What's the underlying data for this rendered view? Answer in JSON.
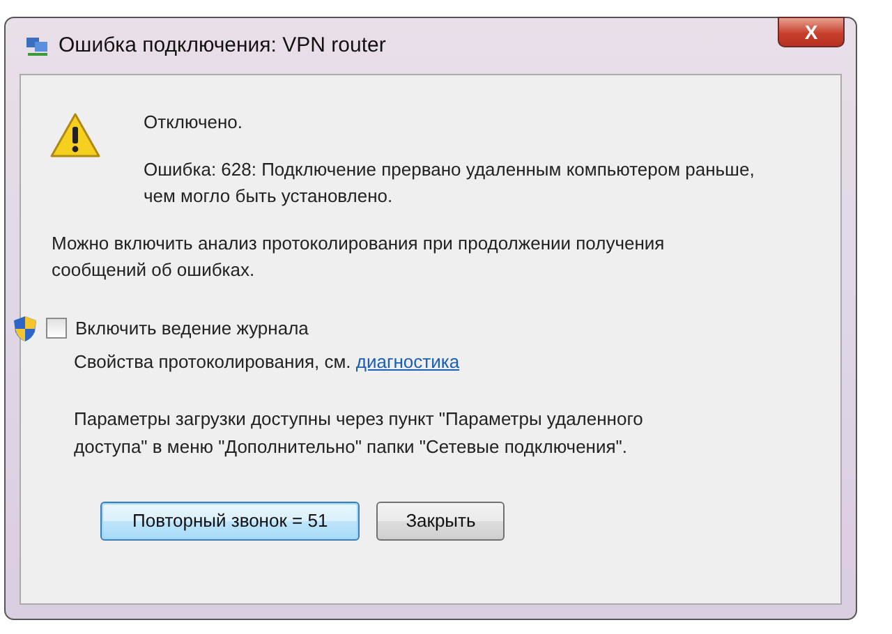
{
  "window": {
    "title": "Ошибка подключения: VPN router",
    "close_label": "X"
  },
  "status": "Отключено.",
  "error": "Ошибка: 628: Подключение прервано удаленным компьютером раньше, чем могло быть установлено.",
  "hint": "Можно включить анализ протоколирования при продолжении получения сообщений об ошибках.",
  "logging": {
    "label": "Включить ведение журнала",
    "checked": false
  },
  "properties": {
    "text": "Свойства протоколирования, см.",
    "link": "диагностика"
  },
  "note": "Параметры загрузки доступны через пункт \"Параметры удаленного доступа\" в меню \"Дополнительно\" папки \"Сетевые подключения\".",
  "buttons": [
    {
      "label": "Повторный звонок = 51",
      "default": true
    },
    {
      "label": "Закрыть",
      "default": false
    }
  ]
}
